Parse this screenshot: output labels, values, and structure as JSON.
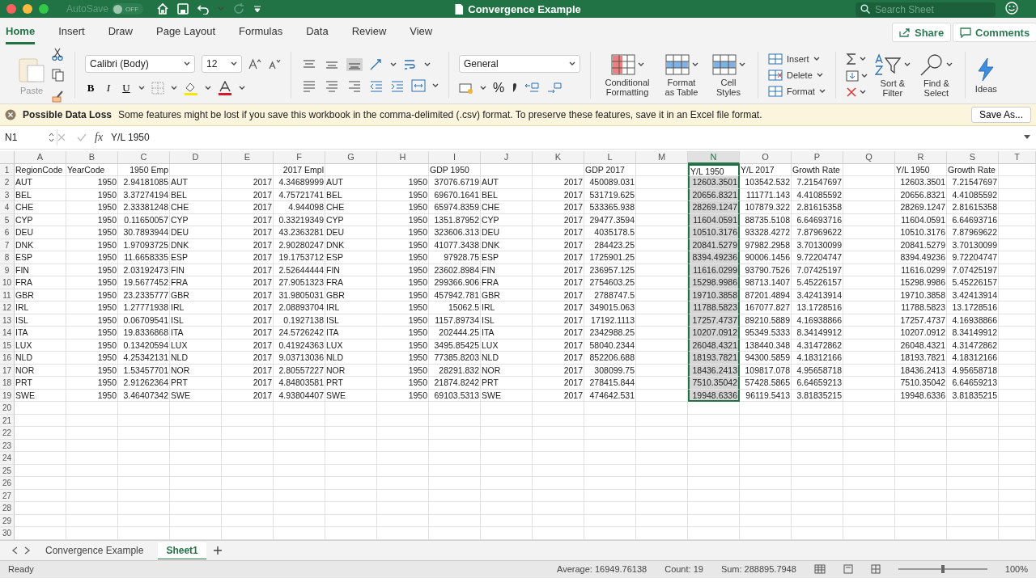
{
  "title_bar": {
    "autosave": "AutoSave",
    "autosave_toggle": {
      "label": "OFF",
      "on": false
    },
    "title": "Convergence Example",
    "search": {
      "placeholder": "Search Sheet"
    }
  },
  "ribbon_tabs": [
    {
      "label": "Home",
      "selected": true
    },
    {
      "label": "Insert",
      "selected": false
    },
    {
      "label": "Draw",
      "selected": false
    },
    {
      "label": "Page Layout",
      "selected": false
    },
    {
      "label": "Formulas",
      "selected": false
    },
    {
      "label": "Data",
      "selected": false
    },
    {
      "label": "Review",
      "selected": false
    },
    {
      "label": "View",
      "selected": false
    }
  ],
  "share": "Share",
  "comments": "Comments",
  "ribbon": {
    "paste": "Paste",
    "font": "Calibri (Body)",
    "font_size": "12",
    "bold": "B",
    "italic": "I",
    "underline": "U",
    "number_format": "General",
    "percent": "%",
    "styles": [
      "Conditional Formatting",
      "Format as Table",
      "Cell Styles"
    ],
    "cells": [
      "Insert",
      "Delete",
      "Format"
    ],
    "editing": [
      "Sort & Filter",
      "Find & Select"
    ],
    "ideas": "Ideas"
  },
  "message_bar": {
    "title": "Possible Data Loss",
    "text": "Some features might be lost if you save this workbook in the comma-delimited (.csv) format. To preserve these features, save it in an Excel file format.",
    "button": "Save As..."
  },
  "formula_bar": {
    "name_box": "N1",
    "fx": "fx",
    "formula": "Y/L 1950"
  },
  "sheet": {
    "columns": [
      {
        "label": "A",
        "selected": false
      },
      {
        "label": "B",
        "selected": false
      },
      {
        "label": "C",
        "selected": false
      },
      {
        "label": "D",
        "selected": false
      },
      {
        "label": "E",
        "selected": false
      },
      {
        "label": "F",
        "selected": false
      },
      {
        "label": "G",
        "selected": false
      },
      {
        "label": "H",
        "selected": false
      },
      {
        "label": "I",
        "selected": false
      },
      {
        "label": "J",
        "selected": false
      },
      {
        "label": "K",
        "selected": false
      },
      {
        "label": "L",
        "selected": false
      },
      {
        "label": "M",
        "selected": false
      },
      {
        "label": "N",
        "selected": true
      },
      {
        "label": "O",
        "selected": false
      },
      {
        "label": "P",
        "selected": false
      },
      {
        "label": "Q",
        "selected": false
      },
      {
        "label": "R",
        "selected": false
      },
      {
        "label": "S",
        "selected": false
      },
      {
        "label": "T",
        "selected": false
      }
    ],
    "rows": [
      {
        "number": "1",
        "cells": [
          "RegionCode",
          "YearCode",
          "1950 Emp",
          null,
          null,
          "2017 Empl",
          null,
          null,
          "GDP 1950",
          null,
          null,
          "GDP 2017",
          null,
          "Y/L 1950",
          "Y/L 2017",
          "Growth Rate",
          null,
          "Y/L 1950",
          "Growth Rate"
        ]
      },
      {
        "number": "2",
        "cells": [
          "AUT",
          "1950",
          "2.94181085",
          "AUT",
          "2017",
          "4.34689999",
          "AUT",
          "1950",
          "37076.6719",
          "AUT",
          "2017",
          "450089.031",
          null,
          "12603.3501",
          "103542.532",
          "7.21547697",
          null,
          "12603.3501",
          "7.21547697"
        ]
      },
      {
        "number": "3",
        "cells": [
          "BEL",
          "1950",
          "3.37274194",
          "BEL",
          "2017",
          "4.75721741",
          "BEL",
          "1950",
          "69670.1641",
          "BEL",
          "2017",
          "531719.625",
          null,
          "20656.8321",
          "111771.143",
          "4.41085592",
          null,
          "20656.8321",
          "4.41085592"
        ]
      },
      {
        "number": "4",
        "cells": [
          "CHE",
          "1950",
          "2.33381248",
          "CHE",
          "2017",
          "4.944098",
          "CHE",
          "1950",
          "65974.8359",
          "CHE",
          "2017",
          "533365.938",
          null,
          "28269.1247",
          "107879.322",
          "2.81615358",
          null,
          "28269.1247",
          "2.81615358"
        ]
      },
      {
        "number": "5",
        "cells": [
          "CYP",
          "1950",
          "0.11650057",
          "CYP",
          "2017",
          "0.33219349",
          "CYP",
          "1950",
          "1351.87952",
          "CYP",
          "2017",
          "29477.3594",
          null,
          "11604.0591",
          "88735.5108",
          "6.64693716",
          null,
          "11604.0591",
          "6.64693716"
        ]
      },
      {
        "number": "6",
        "cells": [
          "DEU",
          "1950",
          "30.7893944",
          "DEU",
          "2017",
          "43.2363281",
          "DEU",
          "1950",
          "323606.313",
          "DEU",
          "2017",
          "4035178.5",
          null,
          "10510.3176",
          "93328.4272",
          "7.87969622",
          null,
          "10510.3176",
          "7.87969622"
        ]
      },
      {
        "number": "7",
        "cells": [
          "DNK",
          "1950",
          "1.97093725",
          "DNK",
          "2017",
          "2.90280247",
          "DNK",
          "1950",
          "41077.3438",
          "DNK",
          "2017",
          "284423.25",
          null,
          "20841.5279",
          "97982.2958",
          "3.70130099",
          null,
          "20841.5279",
          "3.70130099"
        ]
      },
      {
        "number": "8",
        "cells": [
          "ESP",
          "1950",
          "11.6658335",
          "ESP",
          "2017",
          "19.1753712",
          "ESP",
          "1950",
          "97928.75",
          "ESP",
          "2017",
          "1725901.25",
          null,
          "8394.49236",
          "90006.1456",
          "9.72204747",
          null,
          "8394.49236",
          "9.72204747"
        ]
      },
      {
        "number": "9",
        "cells": [
          "FIN",
          "1950",
          "2.03192473",
          "FIN",
          "2017",
          "2.52644444",
          "FIN",
          "1950",
          "23602.8984",
          "FIN",
          "2017",
          "236957.125",
          null,
          "11616.0299",
          "93790.7526",
          "7.07425197",
          null,
          "11616.0299",
          "7.07425197"
        ]
      },
      {
        "number": "10",
        "cells": [
          "FRA",
          "1950",
          "19.5677452",
          "FRA",
          "2017",
          "27.9051323",
          "FRA",
          "1950",
          "299366.906",
          "FRA",
          "2017",
          "2754603.25",
          null,
          "15298.9986",
          "98713.1407",
          "5.45226157",
          null,
          "15298.9986",
          "5.45226157"
        ]
      },
      {
        "number": "11",
        "cells": [
          "GBR",
          "1950",
          "23.2335777",
          "GBR",
          "2017",
          "31.9805031",
          "GBR",
          "1950",
          "457942.781",
          "GBR",
          "2017",
          "2788747.5",
          null,
          "19710.3858",
          "87201.4894",
          "3.42413914",
          null,
          "19710.3858",
          "3.42413914"
        ]
      },
      {
        "number": "12",
        "cells": [
          "IRL",
          "1950",
          "1.27771938",
          "IRL",
          "2017",
          "2.08893704",
          "IRL",
          "1950",
          "15062.5",
          "IRL",
          "2017",
          "349015.063",
          null,
          "11788.5823",
          "167077.827",
          "13.1728516",
          null,
          "11788.5823",
          "13.1728516"
        ]
      },
      {
        "number": "13",
        "cells": [
          "ISL",
          "1950",
          "0.06709541",
          "ISL",
          "2017",
          "0.1927138",
          "ISL",
          "1950",
          "1157.89734",
          "ISL",
          "2017",
          "17192.1113",
          null,
          "17257.4737",
          "89210.5889",
          "4.16938866",
          null,
          "17257.4737",
          "4.16938866"
        ]
      },
      {
        "number": "14",
        "cells": [
          "ITA",
          "1950",
          "19.8336868",
          "ITA",
          "2017",
          "24.5726242",
          "ITA",
          "1950",
          "202444.25",
          "ITA",
          "2017",
          "2342988.25",
          null,
          "10207.0912",
          "95349.5333",
          "8.34149912",
          null,
          "10207.0912",
          "8.34149912"
        ]
      },
      {
        "number": "15",
        "cells": [
          "LUX",
          "1950",
          "0.13420594",
          "LUX",
          "2017",
          "0.41924363",
          "LUX",
          "1950",
          "3495.85425",
          "LUX",
          "2017",
          "58040.2344",
          null,
          "26048.4321",
          "138440.348",
          "4.31472862",
          null,
          "26048.4321",
          "4.31472862"
        ]
      },
      {
        "number": "16",
        "cells": [
          "NLD",
          "1950",
          "4.25342131",
          "NLD",
          "2017",
          "9.03713036",
          "NLD",
          "1950",
          "77385.8203",
          "NLD",
          "2017",
          "852206.688",
          null,
          "18193.7821",
          "94300.5859",
          "4.18312166",
          null,
          "18193.7821",
          "4.18312166"
        ]
      },
      {
        "number": "17",
        "cells": [
          "NOR",
          "1950",
          "1.53457701",
          "NOR",
          "2017",
          "2.80557227",
          "NOR",
          "1950",
          "28291.832",
          "NOR",
          "2017",
          "308099.75",
          null,
          "18436.2413",
          "109817.078",
          "4.95658718",
          null,
          "18436.2413",
          "4.95658718"
        ]
      },
      {
        "number": "18",
        "cells": [
          "PRT",
          "1950",
          "2.91262364",
          "PRT",
          "2017",
          "4.84803581",
          "PRT",
          "1950",
          "21874.8242",
          "PRT",
          "2017",
          "278415.844",
          null,
          "7510.35042",
          "57428.5865",
          "6.64659213",
          null,
          "7510.35042",
          "6.64659213"
        ]
      },
      {
        "number": "19",
        "cells": [
          "SWE",
          "1950",
          "3.46407342",
          "SWE",
          "2017",
          "4.93804407",
          "SWE",
          "1950",
          "69103.5313",
          "SWE",
          "2017",
          "474642.531",
          null,
          "19948.6336",
          "96119.5413",
          "3.81835215",
          null,
          "19948.6336",
          "3.81835215"
        ]
      },
      {
        "number": "20"
      },
      {
        "number": "21"
      },
      {
        "number": "22"
      },
      {
        "number": "23"
      },
      {
        "number": "24"
      },
      {
        "number": "25"
      },
      {
        "number": "26"
      },
      {
        "number": "27"
      },
      {
        "number": "28"
      },
      {
        "number": "29"
      },
      {
        "number": "30"
      }
    ]
  },
  "sheet_tabs": [
    {
      "label": "Convergence Example",
      "selected": false
    },
    {
      "label": "Sheet1",
      "selected": true
    }
  ],
  "status_bar": {
    "status": "Ready",
    "average": "Average: 16949.76138",
    "count": "Count: 19",
    "sum": "Sum: 288895.7948",
    "zoom_slider": {
      "level": 0.5
    },
    "zoom": "100%"
  }
}
